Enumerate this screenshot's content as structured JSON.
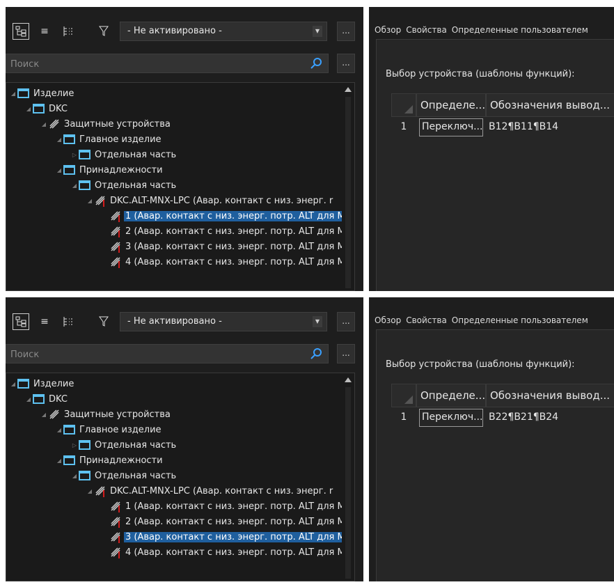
{
  "panels": [
    {
      "toolbar": {
        "filter_value": "- Не активировано -",
        "more_label": "..."
      },
      "search": {
        "placeholder": "Поиск",
        "more_label": "..."
      },
      "tree": [
        {
          "label": "Изделие",
          "icon": "folder-icon"
        },
        {
          "label": "DKC",
          "icon": "folder-icon"
        },
        {
          "label": "Защитные устройства",
          "icon": "device-icon"
        },
        {
          "label": "Главное изделие",
          "icon": "folder-icon"
        },
        {
          "label": "Отдельная часть",
          "icon": "folder-icon"
        },
        {
          "label": "Принадлежности",
          "icon": "folder-icon"
        },
        {
          "label": "Отдельная часть",
          "icon": "folder-icon"
        },
        {
          "label": "DKC.ALT-MNX-LPC (Авар. контакт с низ. энерг. r",
          "icon": "device-icon"
        },
        {
          "label": "1 (Авар. контакт с низ. энерг. потр. ALT для M",
          "icon": "device-icon"
        },
        {
          "label": "2 (Авар. контакт с низ. энерг. потр. ALT для M",
          "icon": "device-icon"
        },
        {
          "label": "3 (Авар. контакт с низ. энерг. потр. ALT для M",
          "icon": "device-icon"
        },
        {
          "label": "4 (Авар. контакт с низ. энерг. потр. ALT для M",
          "icon": "device-icon"
        }
      ],
      "selected_index": 8,
      "right": {
        "tabs": [
          "Обзор",
          "Свойства",
          "Определенные пользователем"
        ],
        "section_title": "Выбор устройства (шаблоны функций):",
        "columns": [
          "Определе...",
          "Обозначения вывод..."
        ],
        "rows": [
          {
            "num": "1",
            "definition": "Переключ...",
            "terminals": "B12¶B11¶B14"
          }
        ]
      }
    },
    {
      "toolbar": {
        "filter_value": "- Не активировано -",
        "more_label": "..."
      },
      "search": {
        "placeholder": "Поиск",
        "more_label": "..."
      },
      "tree": [
        {
          "label": "Изделие",
          "icon": "folder-icon"
        },
        {
          "label": "DKC",
          "icon": "folder-icon"
        },
        {
          "label": "Защитные устройства",
          "icon": "device-icon"
        },
        {
          "label": "Главное изделие",
          "icon": "folder-icon"
        },
        {
          "label": "Отдельная часть",
          "icon": "folder-icon"
        },
        {
          "label": "Принадлежности",
          "icon": "folder-icon"
        },
        {
          "label": "Отдельная часть",
          "icon": "folder-icon"
        },
        {
          "label": "DKC.ALT-MNX-LPC (Авар. контакт с низ. энерг. r",
          "icon": "device-icon"
        },
        {
          "label": "1 (Авар. контакт с низ. энерг. потр. ALT для M",
          "icon": "device-icon"
        },
        {
          "label": "2 (Авар. контакт с низ. энерг. потр. ALT для M",
          "icon": "device-icon"
        },
        {
          "label": "3 (Авар. контакт с низ. энерг. потр. ALT для M",
          "icon": "device-icon"
        },
        {
          "label": "4 (Авар. контакт с низ. энерг. потр. ALT для M",
          "icon": "device-icon"
        }
      ],
      "selected_index": 10,
      "right": {
        "tabs": [
          "Обзор",
          "Свойства",
          "Определенные пользователем"
        ],
        "section_title": "Выбор устройства (шаблоны функций):",
        "columns": [
          "Определе...",
          "Обозначения вывод..."
        ],
        "rows": [
          {
            "num": "1",
            "definition": "Переключ...",
            "terminals": "B22¶B21¶B24"
          }
        ]
      }
    }
  ],
  "colors": {
    "background": "#1e1e1e",
    "selection": "#1f5f9e",
    "folder": "#5ec1f0",
    "device_marker": "#d11c1c"
  }
}
